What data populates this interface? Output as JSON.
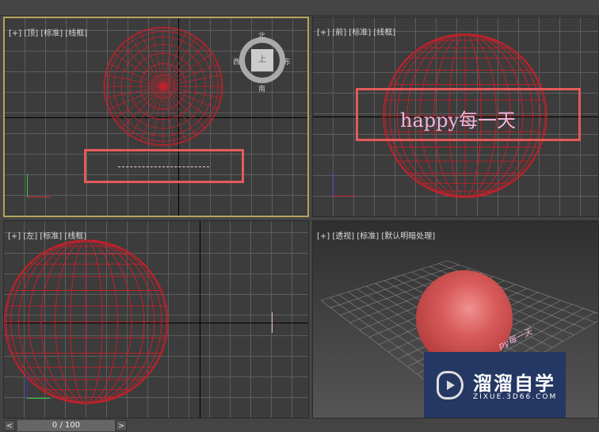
{
  "viewports": {
    "top": {
      "label": "[+] [顶] [标准] [线框]",
      "compass": {
        "n": "北",
        "s": "南",
        "e": "东",
        "w": "西",
        "cube": "上"
      }
    },
    "front": {
      "label": "[+] [前] [标准] [线框]",
      "text": "happy每一天"
    },
    "left": {
      "label": "[+] [左] [标准] [线框]"
    },
    "perspective": {
      "label": "[+] [透视] [标准] [默认明暗处理]",
      "text": "py每一天"
    }
  },
  "timeline": {
    "prev": "<",
    "next": ">",
    "value": "0 / 100"
  },
  "watermark": {
    "title": "溜溜自学",
    "url": "ZIXUE.3D66.COM"
  },
  "colors": {
    "wire": "#c8202a",
    "highlight": "#e55a5a",
    "active_border": "#b8a35b"
  }
}
